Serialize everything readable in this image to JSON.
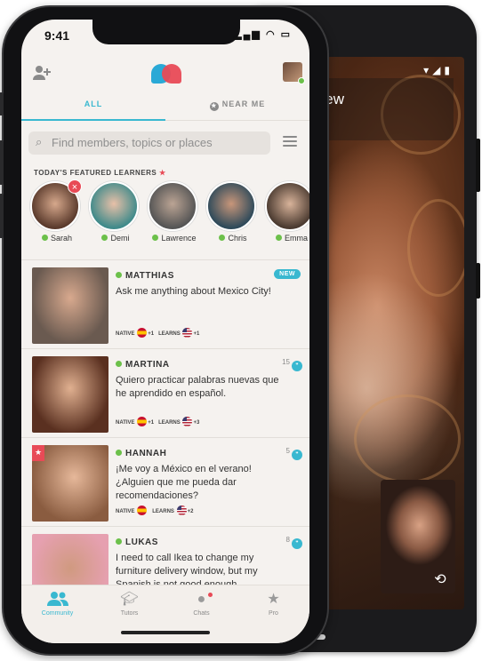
{
  "status": {
    "time": "9:41",
    "icons": "▂▄▆ ◠ ▭"
  },
  "android": {
    "status_icons": "▾◢▮",
    "caption": "ge is the New"
  },
  "tabs": [
    {
      "label": "ALL",
      "active": true
    },
    {
      "label": "NEAR ME",
      "active": false
    }
  ],
  "search": {
    "placeholder": "Find members, topics or places"
  },
  "featured": {
    "title": "TODAY'S FEATURED LEARNERS",
    "learners": [
      {
        "name": "Sarah"
      },
      {
        "name": "Demi"
      },
      {
        "name": "Lawrence"
      },
      {
        "name": "Chris"
      },
      {
        "name": "Emma"
      }
    ]
  },
  "feed": [
    {
      "name": "MATTHIAS",
      "message": "Ask me anything about Mexico City!",
      "badge": "NEW",
      "native_label": "NATIVE",
      "native_extra": "+1",
      "learns_label": "LEARNS",
      "learns_extra": "+1"
    },
    {
      "name": "MARTINA",
      "message": "Quiero practicar palabras nuevas que he aprendido en español.",
      "comments": "15",
      "native_label": "NATIVE",
      "native_extra": "+1",
      "learns_label": "LEARNS",
      "learns_extra": "+3"
    },
    {
      "name": "HANNAH",
      "message": "¡Me voy a México en el verano! ¿Alguien que me pueda dar recomendaciones?",
      "comments": "5",
      "native_label": "NATIVE",
      "native_extra": "",
      "learns_label": "LEARNS",
      "learns_extra": "+2"
    },
    {
      "name": "LUKAS",
      "message": "I need to call Ikea to change my furniture delivery window, but my Spanish is not good enough. Someone",
      "comments": "8"
    }
  ],
  "tabbar": [
    {
      "label": "Community",
      "icon": "community-icon",
      "active": true
    },
    {
      "label": "Tutors",
      "icon": "graduation-cap-icon",
      "active": false
    },
    {
      "label": "Chats",
      "icon": "chat-bubble-icon",
      "active": false
    },
    {
      "label": "Pro",
      "icon": "star-icon",
      "active": false
    }
  ],
  "colors": {
    "accent": "#39b8d0",
    "brand_red": "#e84a56",
    "online": "#6cc04a"
  }
}
